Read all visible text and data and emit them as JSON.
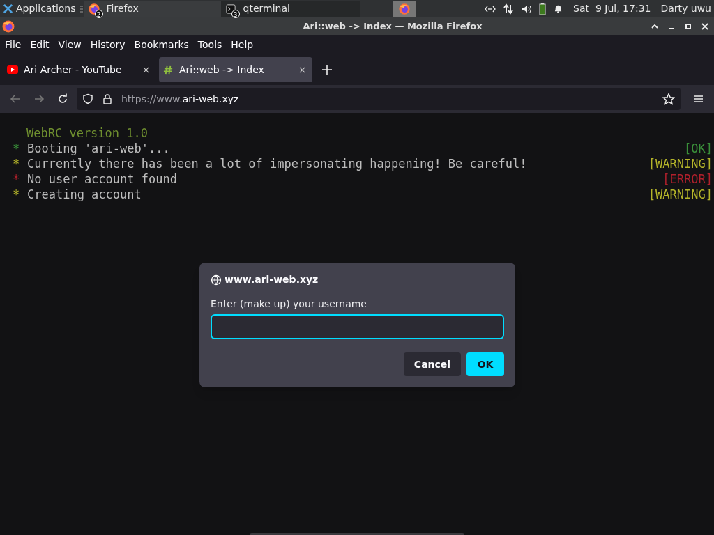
{
  "taskbar": {
    "menu_button": "Applications",
    "tasks": [
      {
        "label": "Firefox",
        "badge": "2",
        "kind": "firefox",
        "selected": true
      },
      {
        "label": "qterminal",
        "badge": "3",
        "kind": "terminal",
        "selected": false
      }
    ],
    "clock": "Sat  9 Jul, 17:31",
    "user": "Darty uwu"
  },
  "window": {
    "title": "Ari::web -> Index — Mozilla Firefox"
  },
  "menu": [
    "File",
    "Edit",
    "View",
    "History",
    "Bookmarks",
    "Tools",
    "Help"
  ],
  "tabs": [
    {
      "label": "Ari Archer - YouTube",
      "kind": "youtube",
      "selected": false
    },
    {
      "label": "Ari::web -> Index",
      "kind": "hash",
      "selected": true
    }
  ],
  "address": {
    "prefix": "https://www.",
    "domain": "ari-web.xyz"
  },
  "console": {
    "header": "WebRC version 1.0",
    "lines": [
      {
        "bullet": "*",
        "text": "Booting 'ari-web'...",
        "status": "[OK]",
        "kind": "ok",
        "underlined": false
      },
      {
        "bullet": "*",
        "text": "Currently there has been a lot of impersonating happening! Be careful!",
        "status": "[WARNING]",
        "kind": "warning",
        "underlined": true
      },
      {
        "bullet": "*",
        "text": "No user account found",
        "status": "[ERROR]",
        "kind": "error",
        "underlined": false
      },
      {
        "bullet": "*",
        "text": "Creating account",
        "status": "[WARNING]",
        "kind": "warning",
        "underlined": false
      }
    ]
  },
  "dialog": {
    "origin": "www.ari-web.xyz",
    "prompt": "Enter (make up) your username",
    "buttons": [
      {
        "label": "Cancel",
        "kind": "secondary"
      },
      {
        "label": "OK",
        "kind": "primary"
      }
    ]
  }
}
